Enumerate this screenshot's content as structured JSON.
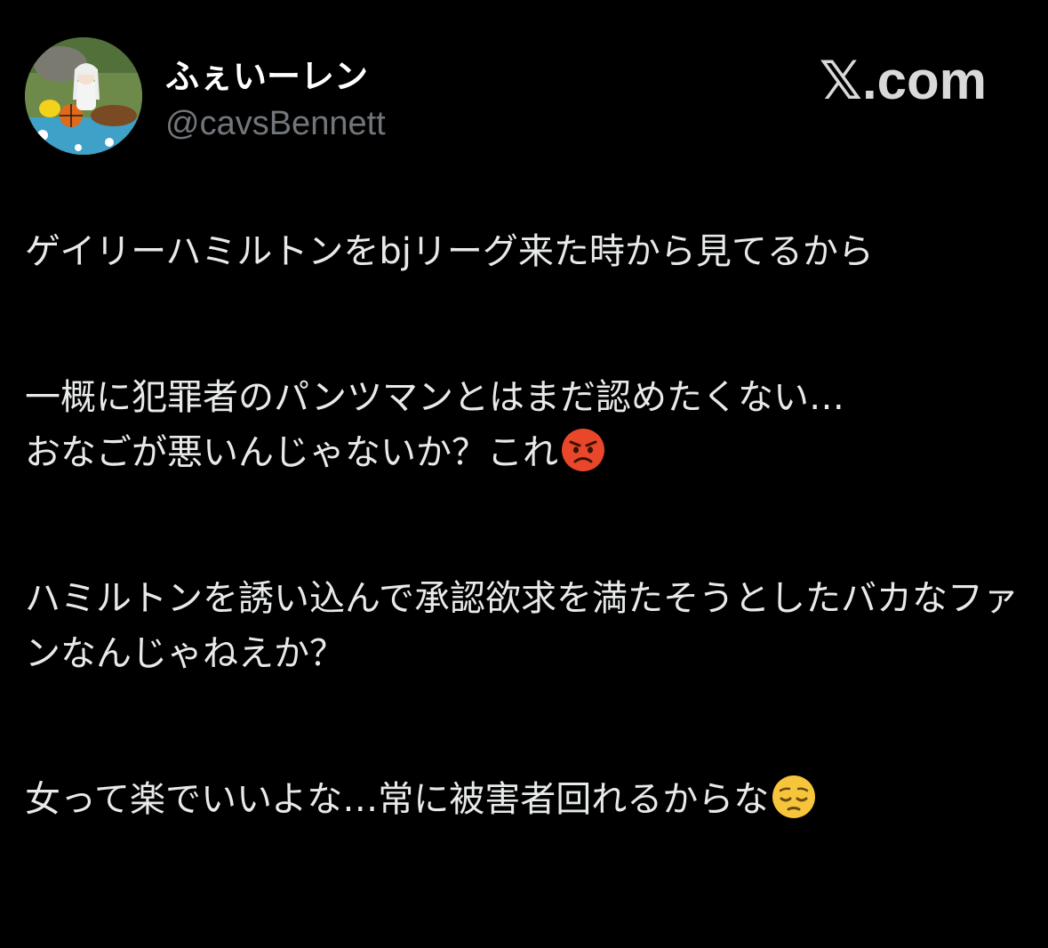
{
  "header": {
    "display_name": "ふぇいーレン",
    "handle": "@cavsBennett",
    "brand_x": "𝕏",
    "brand_suffix": ".com"
  },
  "tweet": {
    "para1": "ゲイリーハミルトンをbjリーグ来た時から見てるから",
    "para2_line1": "一概に犯罪者のパンツマンとはまだ認めたくない…",
    "para2_line2": "おなごが悪いんじゃないか？これ",
    "para2_emoji": "angry-face",
    "para3": "ハミルトンを誘い込んで承認欲求を満たそうとしたバカなファンなんじゃねえか？",
    "para4": "女って楽でいいよな…常に被害者回れるからな",
    "para4_emoji": "pensive-face"
  },
  "colors": {
    "background": "#000000",
    "text": "#e7e9ea",
    "handle": "#71767b",
    "brand": "#d9d9d9"
  }
}
